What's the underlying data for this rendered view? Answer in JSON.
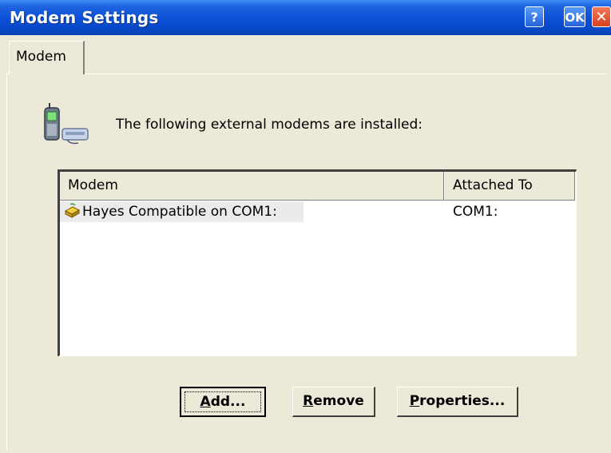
{
  "window": {
    "title": "Modem Settings",
    "help_label": "?",
    "ok_label": "OK",
    "close_label": "✕"
  },
  "tabs": [
    {
      "label": "Modem"
    }
  ],
  "main": {
    "heading": "The following external modems are installed:",
    "icon": "modem-phone-icon"
  },
  "list": {
    "columns": [
      "Modem",
      "Attached To"
    ],
    "rows": [
      {
        "name": "Hayes Compatible on COM1:",
        "attached": "COM1:",
        "icon": "modem-icon"
      }
    ]
  },
  "buttons": {
    "add": {
      "mnemonic": "A",
      "rest": "dd..."
    },
    "remove": {
      "mnemonic": "R",
      "rest": "emove"
    },
    "properties": {
      "mnemonic": "P",
      "rest": "roperties..."
    }
  },
  "colors": {
    "titlebar": "#0a4fd6",
    "face": "#ece9d8",
    "close": "#d8401c"
  }
}
